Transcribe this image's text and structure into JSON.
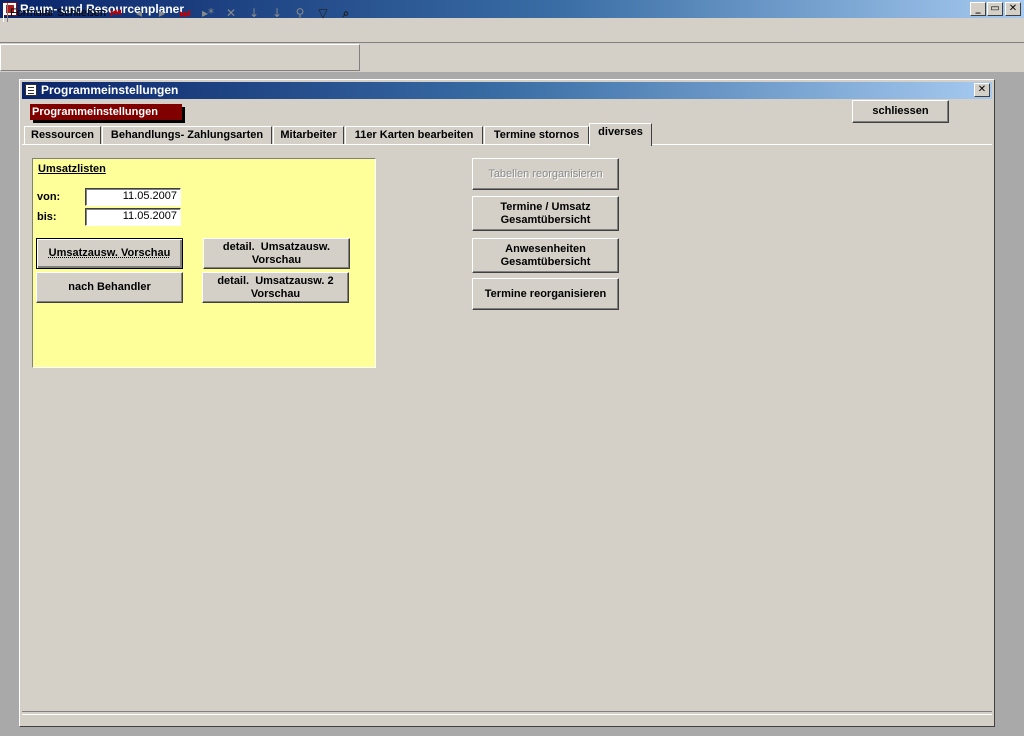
{
  "app": {
    "title": "Raum- und Resourcenplaner",
    "window_buttons": {
      "minimize": "_",
      "restore": "▭",
      "close": "✕"
    }
  },
  "toolbar": {
    "close_form_label": "Formular Schließen",
    "buttons": [
      {
        "name": "first-record-icon",
        "glyph": "⏮"
      },
      {
        "name": "previous-record-icon",
        "glyph": "◂"
      },
      {
        "name": "next-record-icon",
        "glyph": "▸"
      },
      {
        "name": "last-record-icon",
        "glyph": "⏭"
      },
      {
        "name": "new-record-icon",
        "glyph": "▸*"
      },
      {
        "name": "delete-record-icon",
        "glyph": "✕"
      },
      {
        "name": "sort-ascending-icon",
        "glyph": "↓"
      },
      {
        "name": "sort-descending-icon",
        "glyph": "↓"
      },
      {
        "name": "filter-by-selection-icon",
        "glyph": "⚲"
      },
      {
        "name": "apply-filter-icon",
        "glyph": "▽"
      },
      {
        "name": "find-icon",
        "glyph": "⌕"
      }
    ]
  },
  "child_window": {
    "title": "Programmeinstellungen",
    "close": "✕"
  },
  "form": {
    "header_label": "Programmeinstellungen",
    "close_button": "schliessen",
    "tabs": [
      {
        "label": "Ressourcen",
        "active": false
      },
      {
        "label": "Behandlungs- Zahlungsarten",
        "active": false
      },
      {
        "label": "Mitarbeiter",
        "active": false
      },
      {
        "label": "11er Karten bearbeiten",
        "active": false
      },
      {
        "label": "Termine stornos",
        "active": false
      },
      {
        "label": "diverses",
        "active": true
      }
    ],
    "umsatzlisten": {
      "title": "Umsatzlisten",
      "von_label": "von:",
      "von_value": "11.05.2007",
      "bis_label": "bis:",
      "bis_value": "11.05.2007",
      "btn_umsatz_vorschau": "Umsatzausw. Vorschau",
      "btn_nach_behandler": "nach Behandler",
      "btn_detail_1_line1": "detail.  Umsatzausw.",
      "btn_detail_1_line2": "Vorschau",
      "btn_detail_2_line1": "detail.  Umsatzausw. 2",
      "btn_detail_2_line2": "Vorschau"
    },
    "actions": {
      "tabellen_reorg": "Tabellen reorganisieren",
      "termine_umsatz_line1": "Termine / Umsatz",
      "termine_umsatz_line2": "Gesamtübersicht",
      "anwesenheiten_line1": "Anwesenheiten",
      "anwesenheiten_line2": "Gesamtübersicht",
      "termine_reorg": "Termine reorganisieren"
    }
  },
  "colors": {
    "titlebar_start": "#0a246a",
    "titlebar_end": "#a6caf0",
    "face": "#d4d0c8",
    "header_label_bg": "#800000",
    "panel_yellow": "#ffff99"
  }
}
